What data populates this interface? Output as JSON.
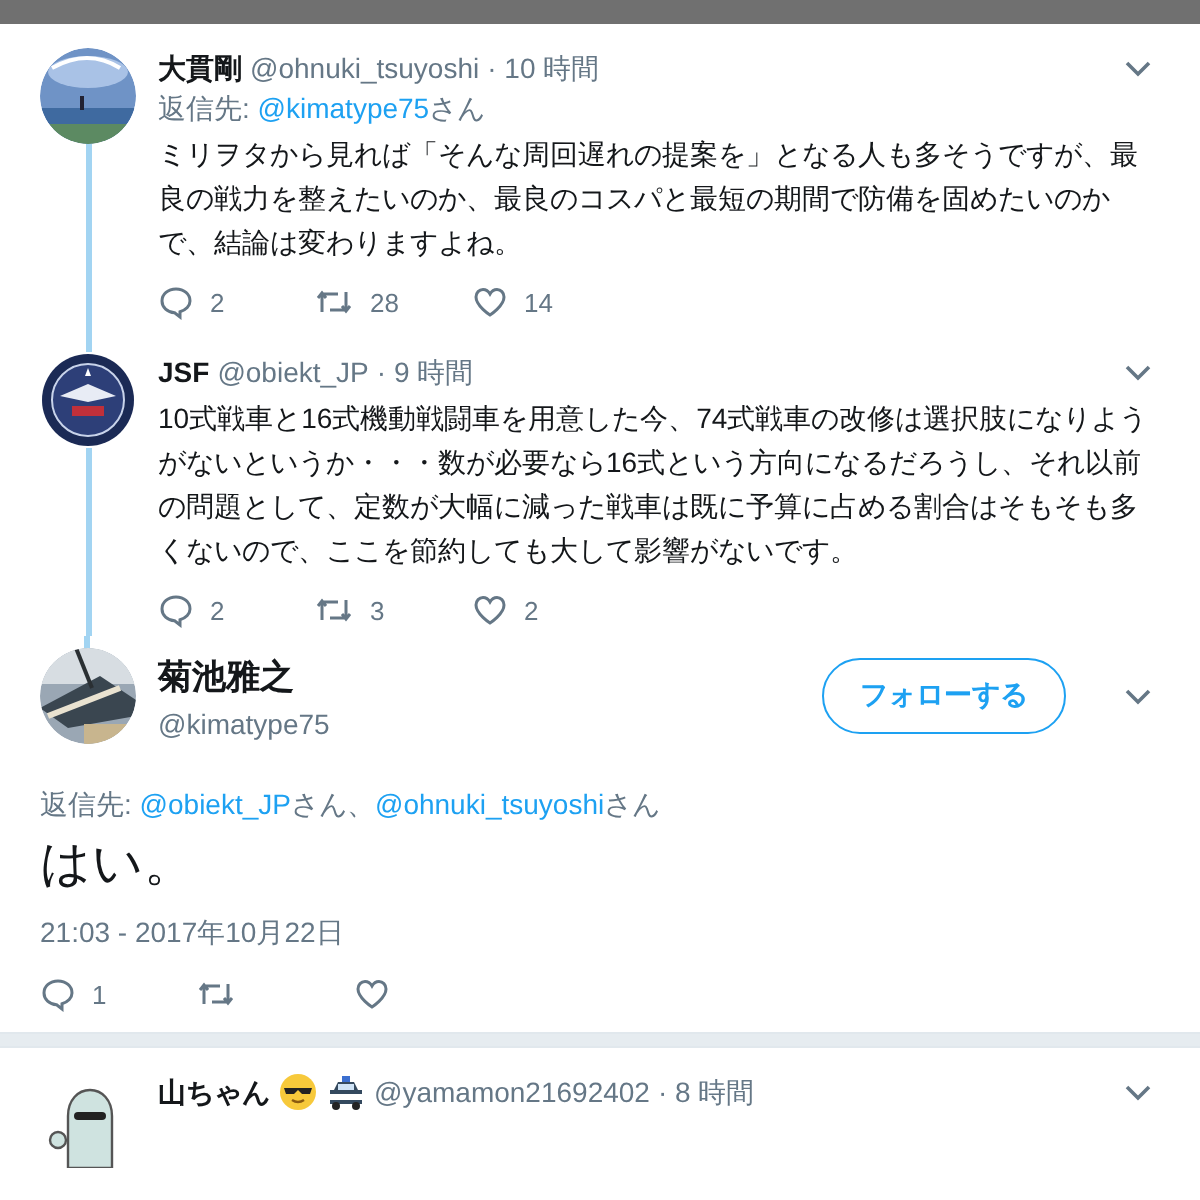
{
  "tweets": [
    {
      "kind": "reply",
      "avatar": {
        "kind": "picture"
      },
      "name": "大貫剛",
      "handle": "@ohnuki_tsuyoshi",
      "time": "· 10 時間",
      "reply_to_label": "返信先:",
      "reply_to": [
        {
          "handle": "@kimatype75",
          "suffix": "さん"
        }
      ],
      "text": "ミリヲタから見れば「そんな周回遅れの提案を」となる人も多そうですが、最良の戦力を整えたいのか、最良のコスパと最短の期間で防備を固めたいのかで、結論は変わりますよね。",
      "replies": "2",
      "retweets": "28",
      "likes": "14",
      "thread_line": true
    },
    {
      "kind": "reply",
      "avatar": {
        "kind": "picture"
      },
      "name": "JSF",
      "handle": "@obiekt_JP",
      "time": "· 9 時間",
      "text": "10式戦車と16式機動戦闘車を用意した今、74式戦車の改修は選択肢になりようがないというか・・・数が必要なら16式という方向になるだろうし、それ以前の問題として、定数が大幅に減った戦車は既に予算に占める割合はそもそも多くないので、ここを節約しても大して影響がないです。",
      "replies": "2",
      "retweets": "3",
      "likes": "2",
      "thread_line": true
    },
    {
      "kind": "focused",
      "avatar": {
        "kind": "picture"
      },
      "name": "菊池雅之",
      "handle": "@kimatype75",
      "follow_button": "フォローする",
      "reply_to_label": "返信先:",
      "reply_to": [
        {
          "handle": "@obiekt_JP",
          "suffix": "さん、"
        },
        {
          "handle": "@ohnuki_tsuyoshi",
          "suffix": "さん"
        }
      ],
      "text": "はい。",
      "timestamp": "21:03 - 2017年10月22日",
      "replies": "1"
    },
    {
      "kind": "reply",
      "avatar": {
        "kind": "character"
      },
      "name": "山ちゃん",
      "name_emoji": [
        {
          "kind": "face"
        },
        {
          "kind": "car"
        }
      ],
      "handle": "@yamamon21692402",
      "time": "· 8 時間"
    }
  ]
}
